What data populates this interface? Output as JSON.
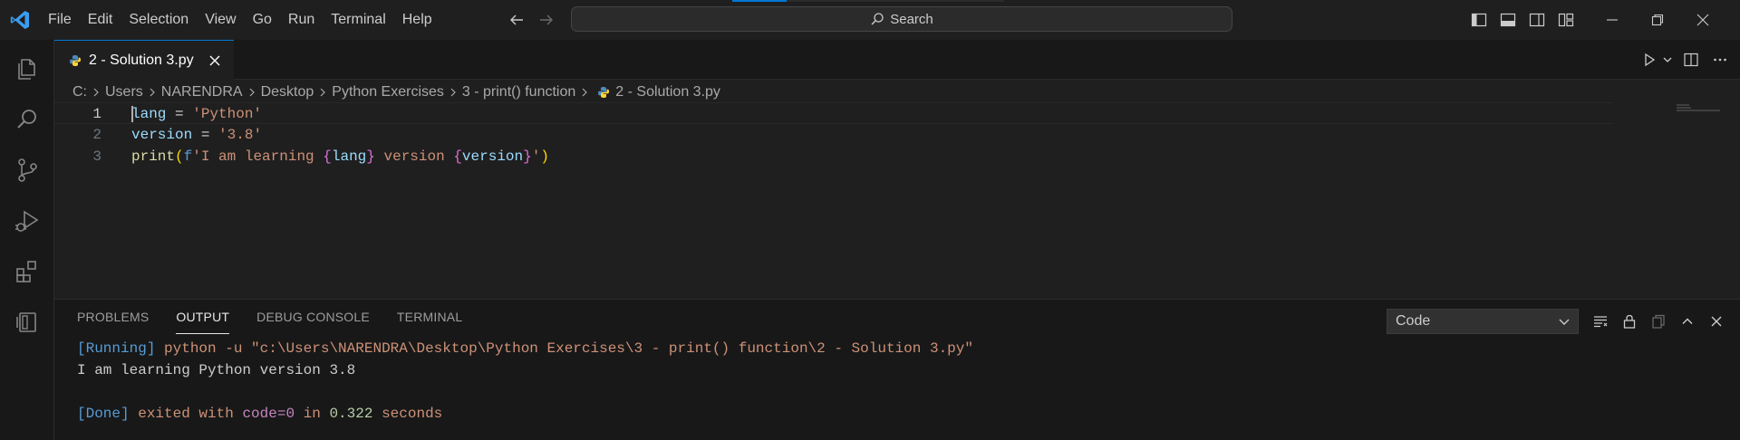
{
  "titlebar": {
    "menu": [
      "File",
      "Edit",
      "Selection",
      "View",
      "Go",
      "Run",
      "Terminal",
      "Help"
    ],
    "search_label": "Search"
  },
  "tab": {
    "label": "2 - Solution 3.py"
  },
  "breadcrumb": [
    "C:",
    "Users",
    "NARENDRA",
    "Desktop",
    "Python Exercises",
    "3 - print() function",
    "2 - Solution 3.py"
  ],
  "editor": {
    "line_numbers": [
      "1",
      "2",
      "3"
    ],
    "line1": {
      "var": "lang",
      "op": " = ",
      "str": "'Python'"
    },
    "line2": {
      "var": "version",
      "op": " = ",
      "str": "'3.8'"
    },
    "line3": {
      "fn": "print",
      "open": "(",
      "prefix": "f",
      "str1": "'I am learning ",
      "b1o": "{",
      "v1": "lang",
      "b1c": "}",
      "str2": " version ",
      "b2o": "{",
      "v2": "version",
      "b2c": "}",
      "str3": "'",
      "close": ")"
    }
  },
  "panel": {
    "tabs": [
      "PROBLEMS",
      "OUTPUT",
      "DEBUG CONSOLE",
      "TERMINAL"
    ],
    "active_tab": "OUTPUT",
    "channel": "Code",
    "output": {
      "run_tag": "[Running]",
      "run_cmd": " python -u \"c:\\Users\\NARENDRA\\Desktop\\Python Exercises\\3 - print() function\\2 - Solution 3.py\"",
      "result": "I am learning Python version 3.8",
      "done_tag": "[Done]",
      "done_text1": " exited with ",
      "done_code": "code=0",
      "done_text2": " in ",
      "done_time": "0.322",
      "done_text3": " seconds"
    }
  },
  "colors": {
    "accent": "#0078d4",
    "background": "#1f1f1f",
    "sidebar": "#181818"
  },
  "icons": {
    "activity": [
      "explorer-icon",
      "search-icon",
      "source-control-icon",
      "run-debug-icon",
      "extensions-icon",
      "remote-explorer-icon"
    ],
    "file": "python-file-icon"
  }
}
